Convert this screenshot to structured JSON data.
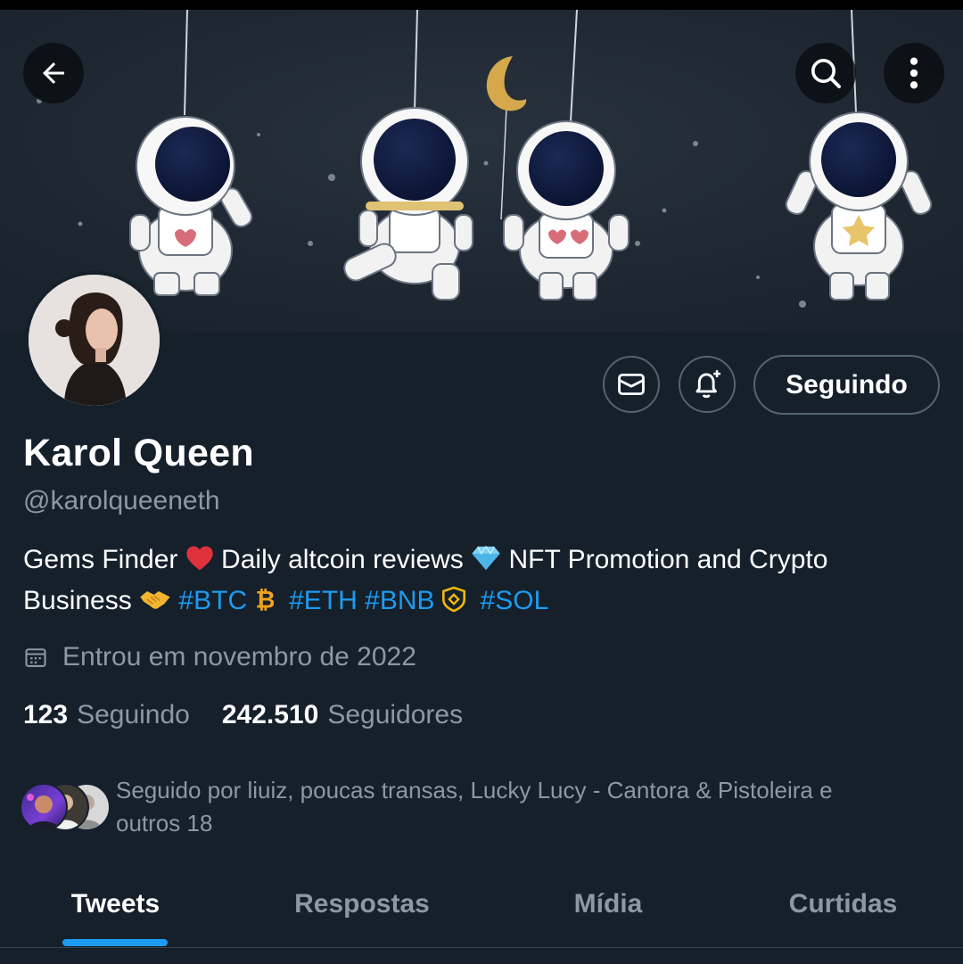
{
  "header": {
    "back_icon": "arrow-left-icon",
    "search_icon": "search-icon",
    "more_icon": "more-vertical-icon"
  },
  "profile": {
    "name": "Karol Queen",
    "handle": "@karolqueeneth",
    "bio_parts": {
      "p1": "Gems Finder ",
      "p2": " Daily altcoin reviews  ",
      "p3": "  NFT Promotion and Crypto Business ",
      "tag_btc": "#BTC",
      "tag_eth": "#ETH",
      "tag_bnb": "#BNB",
      "tag_sol": "#SOL"
    },
    "joined": "Entrou em novembro de 2022",
    "following_count": "123",
    "following_label": "Seguindo",
    "followers_count": "242.510",
    "followers_label": "Seguidores",
    "followed_by": "Seguido por liuiz, poucas transas, Lucky Lucy - Cantora & Pistoleira e outros 18"
  },
  "actions": {
    "message_icon": "mail-icon",
    "notify_icon": "bell-plus-icon",
    "follow_label": "Seguindo"
  },
  "tabs": [
    {
      "label": "Tweets",
      "active": true
    },
    {
      "label": "Respostas",
      "active": false
    },
    {
      "label": "Mídia",
      "active": false
    },
    {
      "label": "Curtidas",
      "active": false
    }
  ],
  "colors": {
    "background": "#15202b",
    "accent": "#1d9bf0",
    "secondary_text": "#8b98a5",
    "border": "#536471"
  }
}
